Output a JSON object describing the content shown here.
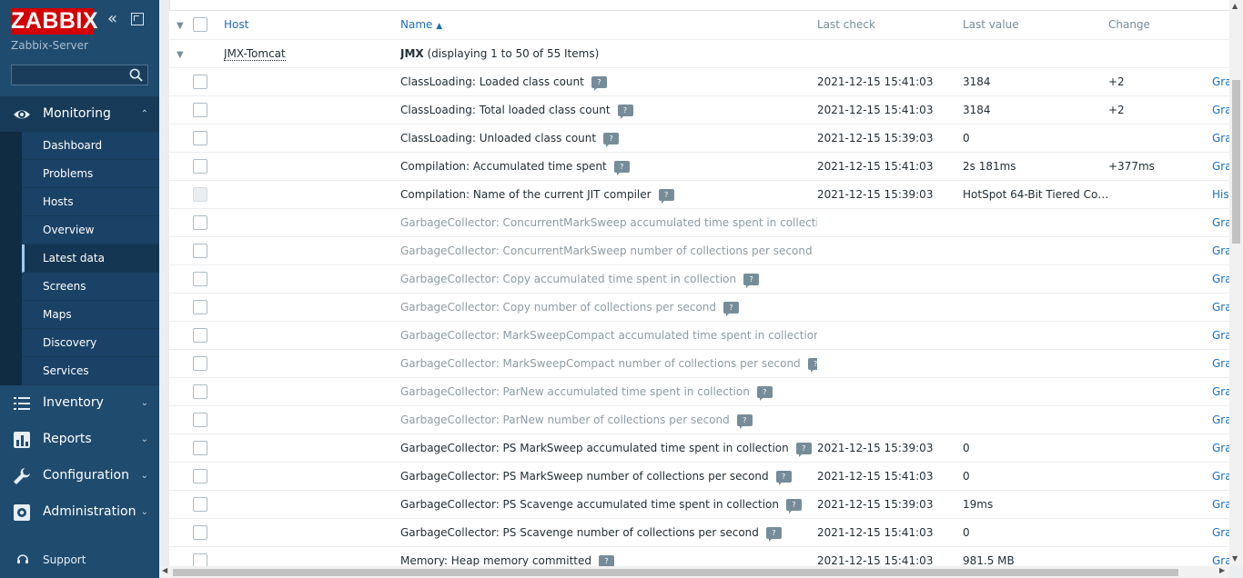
{
  "brand": {
    "logo_text": "ZABBIX",
    "server": "Zabbix-Server",
    "logo_color": "#d40000"
  },
  "search": {
    "value": "",
    "placeholder": ""
  },
  "menu": {
    "monitoring": "Monitoring",
    "inventory": "Inventory",
    "reports": "Reports",
    "configuration": "Configuration",
    "administration": "Administration",
    "support": "Support",
    "monitoring_items": [
      "Dashboard",
      "Problems",
      "Hosts",
      "Overview",
      "Latest data",
      "Screens",
      "Maps",
      "Discovery",
      "Services"
    ],
    "selected": "Latest data"
  },
  "table": {
    "headers": {
      "host": "Host",
      "name": "Name",
      "last_check": "Last check",
      "last_value": "Last value",
      "change": "Change"
    },
    "group": {
      "host": "JMX-Tomcat",
      "app": "JMX",
      "info": "(displaying 1 to 50 of 55 Items)"
    },
    "rows": [
      {
        "name": "ClassLoading: Loaded class count",
        "last_check": "2021-12-15 15:41:03",
        "last_value": "3184",
        "change": "+2",
        "action": "Gra",
        "grey": false,
        "disabled": false
      },
      {
        "name": "ClassLoading: Total loaded class count",
        "last_check": "2021-12-15 15:41:03",
        "last_value": "3184",
        "change": "+2",
        "action": "Gra",
        "grey": false,
        "disabled": false
      },
      {
        "name": "ClassLoading: Unloaded class count",
        "last_check": "2021-12-15 15:39:03",
        "last_value": "0",
        "change": "",
        "action": "Gra",
        "grey": false,
        "disabled": false
      },
      {
        "name": "Compilation: Accumulated time spent",
        "last_check": "2021-12-15 15:41:03",
        "last_value": "2s 181ms",
        "change": "+377ms",
        "action": "Gra",
        "grey": false,
        "disabled": false
      },
      {
        "name": "Compilation: Name of the current JIT compiler",
        "last_check": "2021-12-15 15:39:03",
        "last_value": "HotSpot 64-Bit Tiered Co…",
        "change": "",
        "action": "Hist",
        "grey": false,
        "disabled": true
      },
      {
        "name": "GarbageCollector: ConcurrentMarkSweep accumulated time spent in collection",
        "last_check": "",
        "last_value": "",
        "change": "",
        "action": "Gra",
        "grey": true,
        "disabled": false
      },
      {
        "name": "GarbageCollector: ConcurrentMarkSweep number of collections per second",
        "last_check": "",
        "last_value": "",
        "change": "",
        "action": "Gra",
        "grey": true,
        "disabled": false
      },
      {
        "name": "GarbageCollector: Copy accumulated time spent in collection",
        "last_check": "",
        "last_value": "",
        "change": "",
        "action": "Gra",
        "grey": true,
        "disabled": false
      },
      {
        "name": "GarbageCollector: Copy number of collections per second",
        "last_check": "",
        "last_value": "",
        "change": "",
        "action": "Gra",
        "grey": true,
        "disabled": false
      },
      {
        "name": "GarbageCollector: MarkSweepCompact accumulated time spent in collection",
        "last_check": "",
        "last_value": "",
        "change": "",
        "action": "Gra",
        "grey": true,
        "disabled": false
      },
      {
        "name": "GarbageCollector: MarkSweepCompact number of collections per second",
        "last_check": "",
        "last_value": "",
        "change": "",
        "action": "Gra",
        "grey": true,
        "disabled": false
      },
      {
        "name": "GarbageCollector: ParNew accumulated time spent in collection",
        "last_check": "",
        "last_value": "",
        "change": "",
        "action": "Gra",
        "grey": true,
        "disabled": false
      },
      {
        "name": "GarbageCollector: ParNew number of collections per second",
        "last_check": "",
        "last_value": "",
        "change": "",
        "action": "Gra",
        "grey": true,
        "disabled": false
      },
      {
        "name": "GarbageCollector: PS MarkSweep accumulated time spent in collection",
        "last_check": "2021-12-15 15:39:03",
        "last_value": "0",
        "change": "",
        "action": "Gra",
        "grey": false,
        "disabled": false
      },
      {
        "name": "GarbageCollector: PS MarkSweep number of collections per second",
        "last_check": "2021-12-15 15:41:03",
        "last_value": "0",
        "change": "",
        "action": "Gra",
        "grey": false,
        "disabled": false
      },
      {
        "name": "GarbageCollector: PS Scavenge accumulated time spent in collection",
        "last_check": "2021-12-15 15:39:03",
        "last_value": "19ms",
        "change": "",
        "action": "Gra",
        "grey": false,
        "disabled": false
      },
      {
        "name": "GarbageCollector: PS Scavenge number of collections per second",
        "last_check": "2021-12-15 15:41:03",
        "last_value": "0",
        "change": "",
        "action": "Gra",
        "grey": false,
        "disabled": false
      },
      {
        "name": "Memory: Heap memory committed",
        "last_check": "2021-12-15 15:41:03",
        "last_value": "981.5 MB",
        "change": "",
        "action": "Gra",
        "grey": false,
        "disabled": false
      }
    ]
  },
  "hint_glyph": "?",
  "icons": [
    "eye-icon",
    "list-icon",
    "bar-chart-icon",
    "wrench-icon",
    "gear-icon",
    "headset-icon",
    "search-icon"
  ]
}
